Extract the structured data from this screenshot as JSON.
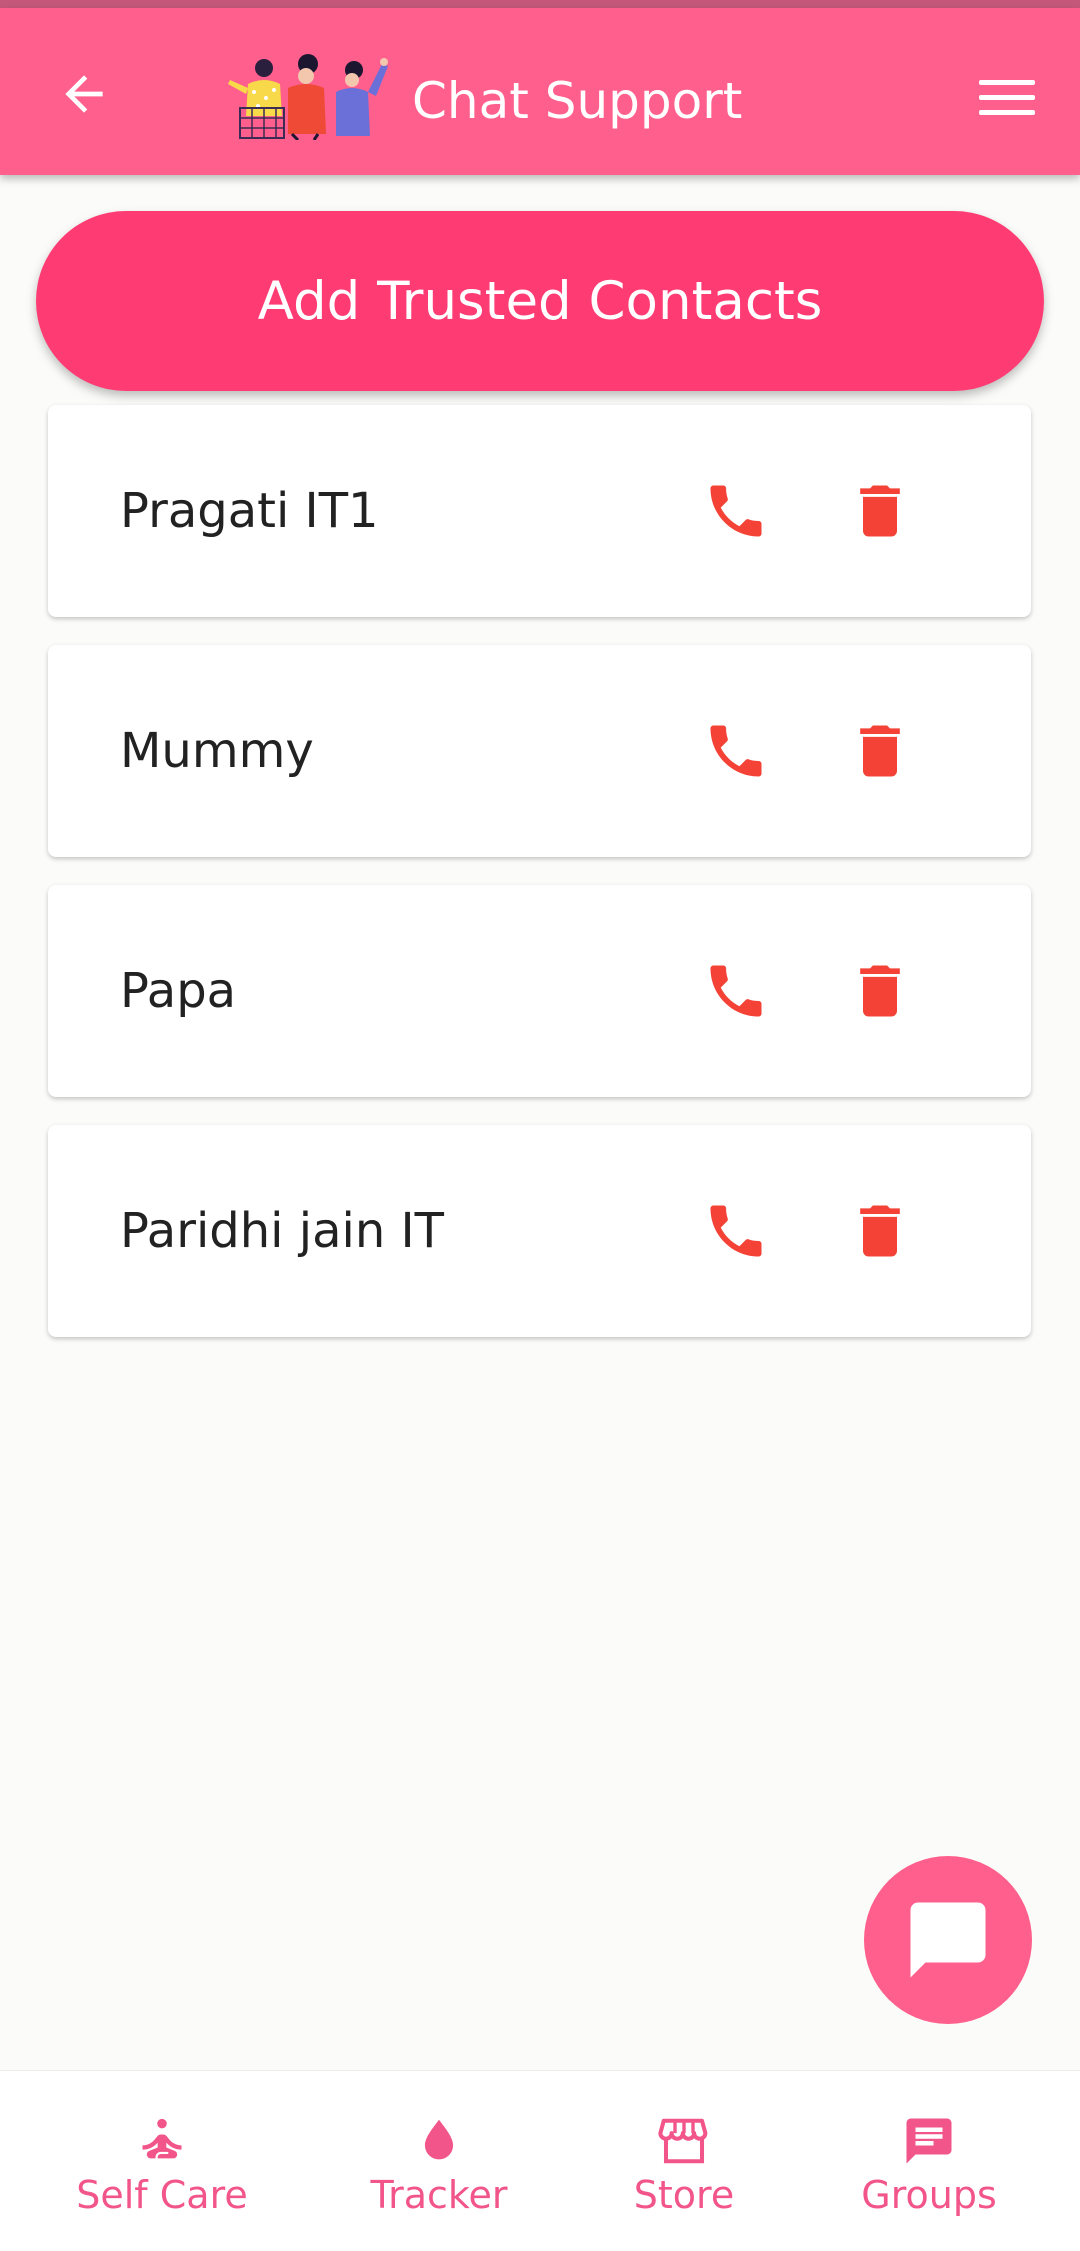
{
  "header": {
    "title": "Chat Support",
    "back_icon": "arrow-left-icon",
    "menu_icon": "hamburger-menu-icon",
    "logo_icon": "women-group-logo-icon",
    "bar_color": "#ff5f8c"
  },
  "add_button": {
    "label": "Add Trusted Contacts",
    "color": "#ff3b74"
  },
  "contacts": [
    {
      "name": "Pragati IT1"
    },
    {
      "name": "Mummy"
    },
    {
      "name": "Papa"
    },
    {
      "name": "Paridhi jain IT"
    }
  ],
  "contact_actions": {
    "call_icon": "phone-icon",
    "delete_icon": "trash-icon",
    "icon_color": "#f44336"
  },
  "fab": {
    "icon": "chat-bubble-icon",
    "color": "#ff5f8c"
  },
  "bottom_nav": {
    "items": [
      {
        "label": "Self Care",
        "icon": "meditation-icon"
      },
      {
        "label": "Tracker",
        "icon": "drop-icon"
      },
      {
        "label": "Store",
        "icon": "storefront-icon"
      },
      {
        "label": "Groups",
        "icon": "message-icon"
      }
    ],
    "color": "#f2558a"
  }
}
